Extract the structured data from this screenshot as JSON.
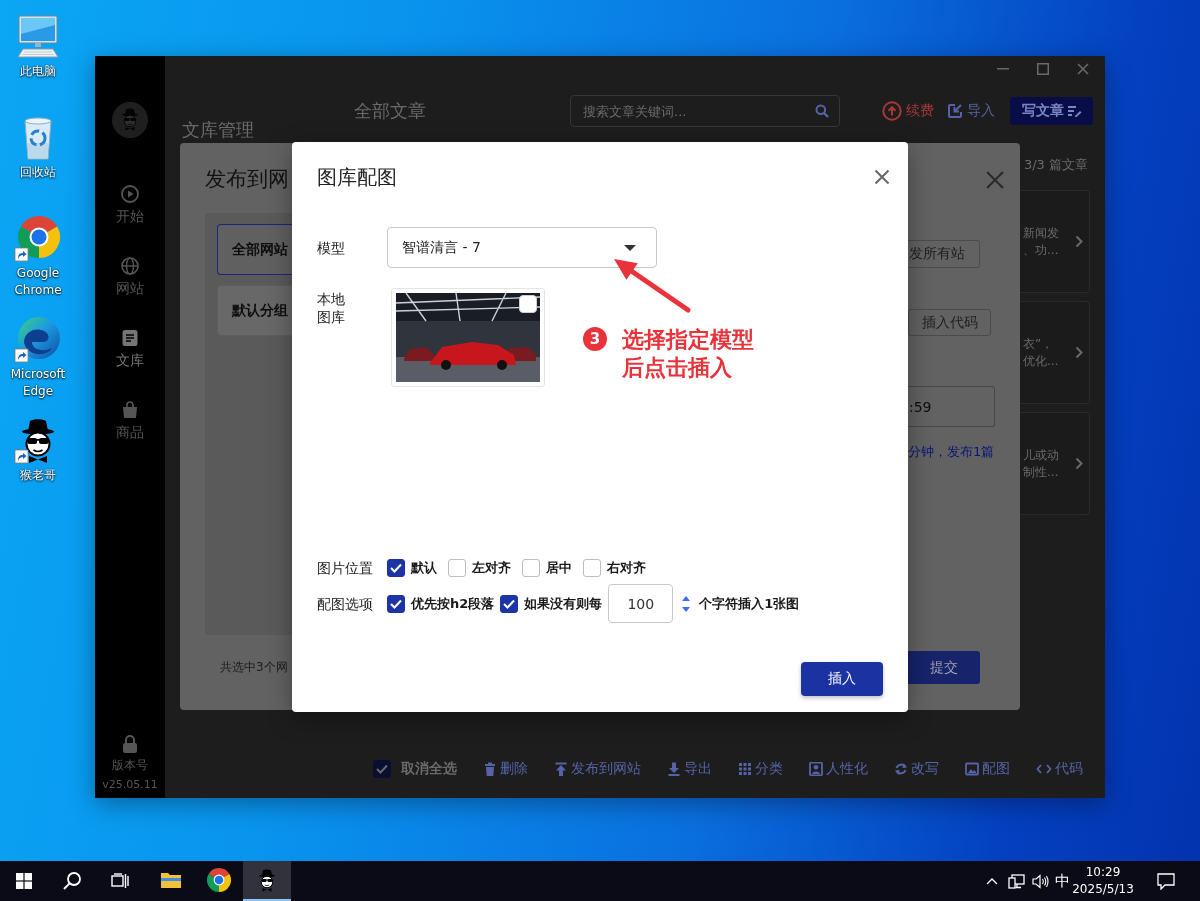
{
  "desktop": {
    "icons": [
      {
        "kind": "computer",
        "label": "此电脑",
        "shortcut": false
      },
      {
        "kind": "recycle_bin",
        "label": "回收站",
        "shortcut": false
      },
      {
        "kind": "chrome",
        "label": "Google Chrome",
        "shortcut": true
      },
      {
        "kind": "edge",
        "label": "Microsoft Edge",
        "shortcut": true
      },
      {
        "kind": "monkey",
        "label": "猴老哥",
        "shortcut": true
      }
    ]
  },
  "app_window": {
    "sidebar": {
      "items": [
        {
          "kind": "start",
          "label": "开始",
          "selected": false
        },
        {
          "kind": "sites",
          "label": "网站",
          "selected": false
        },
        {
          "kind": "library",
          "label": "文库",
          "selected": true
        },
        {
          "kind": "products",
          "label": "商品",
          "selected": false
        }
      ],
      "version_label": "版本号",
      "version": "v25.05.11"
    },
    "library_title": "文库管理",
    "header": {
      "title": "全部文章",
      "search_placeholder": "搜索文章关键词...",
      "renew": "续费",
      "import": "导入",
      "write": "写文章"
    },
    "article_count": "3/3 篇文章",
    "articles": [
      {
        "lines": [
          "新闻发",
          "、功..."
        ]
      },
      {
        "lines": [
          "衣”，",
          "优化..."
        ]
      },
      {
        "lines": [
          "儿或动",
          "制性..."
        ]
      }
    ],
    "toolbar": {
      "select_all": {
        "label": "取消全选",
        "checked": true
      },
      "actions": [
        {
          "kind": "delete",
          "label": "删除"
        },
        {
          "kind": "publish",
          "label": "发布到网站"
        },
        {
          "kind": "export",
          "label": "导出"
        },
        {
          "kind": "category",
          "label": "分类"
        },
        {
          "kind": "humanize",
          "label": "人性化"
        },
        {
          "kind": "rewrite",
          "label": "改写"
        },
        {
          "kind": "image",
          "label": "配图"
        },
        {
          "kind": "code",
          "label": "代码"
        }
      ]
    }
  },
  "publish_dialog": {
    "title": "发布到网",
    "groups": [
      {
        "label": "全部网站",
        "selected": true
      },
      {
        "label": "默认分组",
        "selected": false
      }
    ],
    "summary": "共选中3个网",
    "publish_all": "发所有站",
    "insert_code": "插入代码",
    "time_value": ":59",
    "schedule_note": "分钟，发布1篇",
    "submit": "提交"
  },
  "image_dialog": {
    "title": "图库配图",
    "model_label": "模型",
    "model": "智谱清言 - 7",
    "library_label": "本地图库",
    "images": [
      {
        "checked": false
      }
    ],
    "position_label": "图片位置",
    "positions": [
      {
        "label": "默认",
        "checked": true
      },
      {
        "label": "左对齐",
        "checked": false
      },
      {
        "label": "居中",
        "checked": false
      },
      {
        "label": "右对齐",
        "checked": false
      }
    ],
    "options_label": "配图选项",
    "options": [
      {
        "label": "优先按h2段落",
        "checked": true
      },
      {
        "label": "如果没有则每",
        "checked": true
      }
    ],
    "interval": "100",
    "interval_suffix": "个字符插入1张图",
    "insert": "插入"
  },
  "annotation": {
    "step": "3",
    "text": "选择指定模型后点击插入"
  },
  "taskbar": {
    "apps": [
      {
        "kind": "explorer",
        "selected": false
      },
      {
        "kind": "chrome",
        "selected": false
      },
      {
        "kind": "monkey",
        "selected": true
      }
    ],
    "ime": "中",
    "time": "10:29",
    "date": "2025/5/13"
  }
}
